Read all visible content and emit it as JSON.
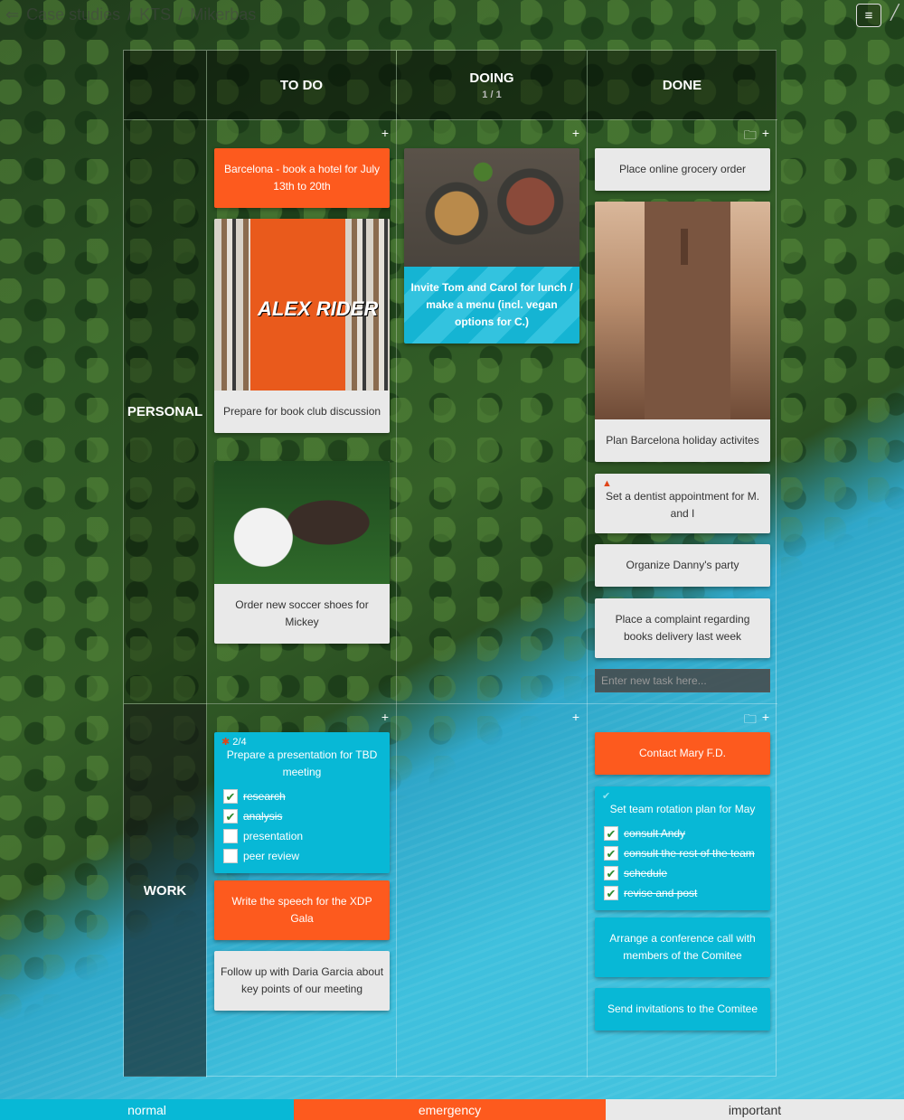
{
  "breadcrumbs": [
    "Case studies",
    "KTS",
    "Mikerbas"
  ],
  "columns": [
    {
      "title": "TO DO",
      "sub": ""
    },
    {
      "title": "DOING",
      "sub": "1 / 1"
    },
    {
      "title": "DONE",
      "sub": ""
    }
  ],
  "rows": [
    "PERSONAL",
    "WORK"
  ],
  "personal": {
    "todo": [
      "Barcelona - book a hotel for July 13th to 20th",
      "Prepare for book club discussion",
      "Order new soccer shoes for Mickey"
    ],
    "book_cover_text": "ALEX RIDER",
    "doing": [
      "Invite Tom and Carol for lunch / make a menu (incl. vegan options for C.)"
    ],
    "done": [
      "Place online grocery order",
      "Plan Barcelona holiday activites",
      "Set a dentist appointment for M. and I",
      "Organize Danny's party",
      "Place a complaint regarding books delivery last week"
    ],
    "new_task_placeholder": "Enter new task here..."
  },
  "work": {
    "todo": [
      {
        "progress": "2/4",
        "title": "Prepare a presentation for TBD meeting",
        "items": [
          {
            "label": "research",
            "done": true
          },
          {
            "label": "analysis",
            "done": true
          },
          {
            "label": "presentation",
            "done": false
          },
          {
            "label": "peer review",
            "done": false
          }
        ]
      },
      "Write the speech for the XDP Gala",
      "Follow up with Daria Garcia about key points of our meeting"
    ],
    "done": [
      "Contact Mary F.D.",
      {
        "title": "Set team rotation plan for May",
        "items": [
          {
            "label": "consult Andy",
            "done": true
          },
          {
            "label": "consult the rest of the team",
            "done": true
          },
          {
            "label": "schedule",
            "done": true
          },
          {
            "label": "revise and post",
            "done": true
          }
        ]
      },
      "Arrange a conference call with members of the Comitee",
      "Send invitations to the Comitee"
    ]
  },
  "legend": [
    "normal",
    "emergency",
    "important"
  ],
  "colors": {
    "normal": "#08b8d6",
    "emergency": "#fd5a1e",
    "important": "#e9e9e9"
  },
  "icons": {
    "add": "plus-icon",
    "archive": "folder-icon",
    "menu": "hamburger-icon",
    "back": "back-arrow-icon"
  }
}
